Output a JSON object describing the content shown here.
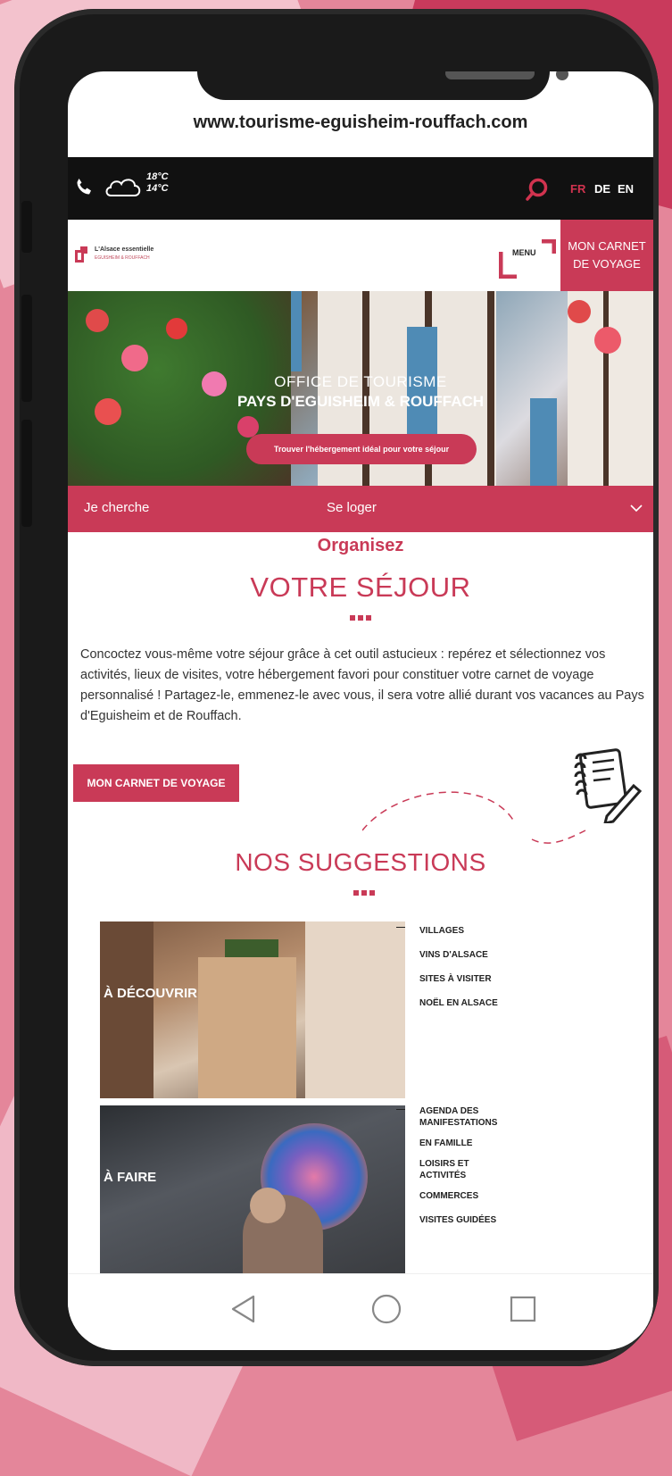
{
  "browser": {
    "url": "www.tourisme-eguisheim-rouffach.com"
  },
  "topbar": {
    "temp_high": "18°C",
    "temp_low": "14°C",
    "languages": [
      "FR",
      "DE",
      "EN"
    ],
    "active_language": "FR",
    "accent": "#c93a57"
  },
  "header": {
    "logo_line1": "L'Alsace essentielle",
    "logo_line2": "EGUISHEIM & ROUFFACH",
    "menu_label": "MENU",
    "carnet_line1": "MON CARNET",
    "carnet_line2": "DE VOYAGE"
  },
  "hero": {
    "line1": "OFFICE DE TOURISME",
    "line2": "PAYS D'EGUISHEIM & ROUFFACH",
    "button": "Trouver l'hébergement idéal pour votre séjour"
  },
  "search": {
    "label": "Je cherche",
    "value": "Se loger"
  },
  "sejour": {
    "kicker": "Organisez",
    "title": "VOTRE SÉJOUR",
    "body": "Concoctez vous-même votre séjour grâce à cet outil astucieux : repérez et sélectionnez vos activités, lieux de visites, votre hébergement favori pour constituer votre carnet de voyage personnalisé ! Partagez-le, emmenez-le avec vous, il sera votre allié durant vos vacances au Pays d'Eguisheim et de Rouffach.",
    "button": "MON CARNET DE VOYAGE"
  },
  "suggestions": {
    "title": "NOS SUGGESTIONS",
    "cards": [
      {
        "title": "À DÉCOUVRIR",
        "links": [
          "VILLAGES",
          "VINS D'ALSACE",
          "SITES À VISITER",
          "NOËL EN ALSACE"
        ]
      },
      {
        "title": "À FAIRE",
        "links": [
          "AGENDA DES MANIFESTATIONS",
          "EN FAMILLE",
          "LOISIRS ET ACTIVITÉS",
          "COMMERCES",
          "VISITES GUIDÉES"
        ]
      }
    ]
  }
}
